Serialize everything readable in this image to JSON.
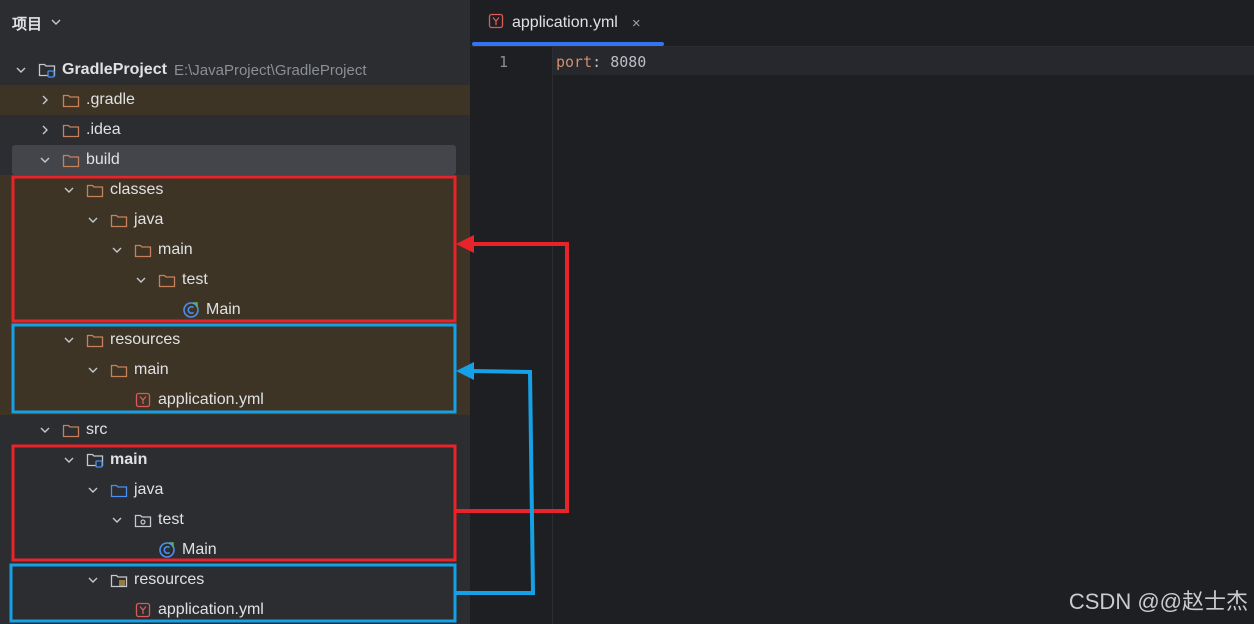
{
  "project_panel": {
    "title": "项目",
    "tree": [
      {
        "label": "GradleProject",
        "path": "E:\\JavaProject\\GradleProject",
        "icon": "module-folder-icon",
        "expanded": true,
        "bold": true
      },
      {
        "label": ".gradle",
        "icon": "folder-icon",
        "expanded": false,
        "excluded": true
      },
      {
        "label": ".idea",
        "icon": "folder-icon",
        "expanded": false
      },
      {
        "label": "build",
        "icon": "folder-icon",
        "expanded": true,
        "selected": true
      },
      {
        "label": "classes",
        "icon": "folder-icon",
        "expanded": true,
        "excluded": true
      },
      {
        "label": "java",
        "icon": "folder-icon",
        "expanded": true,
        "excluded": true
      },
      {
        "label": "main",
        "icon": "folder-icon",
        "expanded": true,
        "excluded": true
      },
      {
        "label": "test",
        "icon": "folder-icon",
        "expanded": true,
        "excluded": true
      },
      {
        "label": "Main",
        "icon": "compiled-class-icon",
        "excluded": true
      },
      {
        "label": "resources",
        "icon": "folder-icon",
        "expanded": true,
        "excluded": true
      },
      {
        "label": "main",
        "icon": "folder-icon",
        "expanded": true,
        "excluded": true
      },
      {
        "label": "application.yml",
        "icon": "yaml-file-icon",
        "excluded": true
      },
      {
        "label": "src",
        "icon": "folder-icon",
        "expanded": true
      },
      {
        "label": "main",
        "icon": "source-module-folder-icon",
        "expanded": true,
        "bold": true
      },
      {
        "label": "java",
        "icon": "source-folder-icon",
        "expanded": true
      },
      {
        "label": "test",
        "icon": "package-icon",
        "expanded": true
      },
      {
        "label": "Main",
        "icon": "compiled-class-icon"
      },
      {
        "label": "resources",
        "icon": "resources-folder-icon",
        "expanded": true
      },
      {
        "label": "application.yml",
        "icon": "yaml-file-icon"
      }
    ]
  },
  "editor": {
    "tab": {
      "label": "application.yml",
      "icon": "yaml-file-icon",
      "close": "×"
    },
    "lines": [
      {
        "number": "1",
        "key": "port",
        "sep": ": ",
        "value": "8080"
      }
    ]
  },
  "watermark": "CSDN @@赵士杰",
  "colors": {
    "excluded_bg": "#3e3425",
    "folder_orange": "#c8805a",
    "source_blue": "#4a8ff0",
    "annotation_red": "#e8232a",
    "annotation_blue": "#16a0e6",
    "accent": "#3574f0"
  }
}
